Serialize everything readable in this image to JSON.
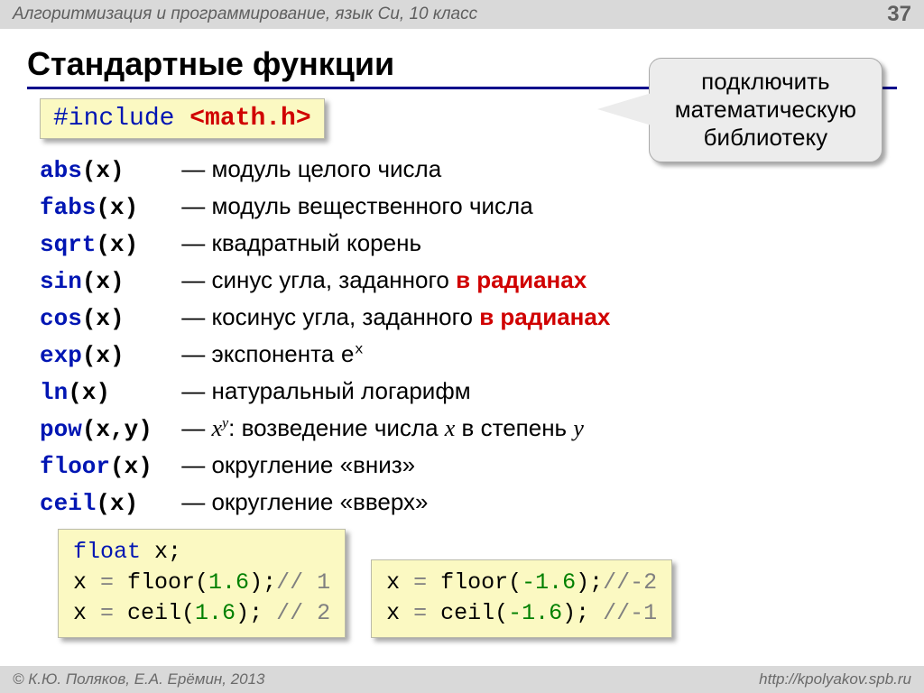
{
  "header": {
    "title": "Алгоритмизация и программирование, язык Си, 10 класс",
    "page": "37"
  },
  "title": "Стандартные функции",
  "include": {
    "kw": "#include",
    "lib": "<math.h>"
  },
  "callout": {
    "l1": "подключить",
    "l2": "математическую",
    "l3": "библиотеку"
  },
  "funcs": [
    {
      "name": "abs",
      "args": "(x)",
      "dash": "—",
      "d1": "модуль целого числа"
    },
    {
      "name": "fabs",
      "args": "(x)",
      "dash": "—",
      "d1": "модуль вещественного числа"
    },
    {
      "name": "sqrt",
      "args": "(x)",
      "dash": "—",
      "d1": "квадратный корень"
    },
    {
      "name": "sin",
      "args": "(x)",
      "dash": "—",
      "d1": "синус угла, заданного ",
      "d2": "в радианах"
    },
    {
      "name": "cos",
      "args": "(x)",
      "dash": "—",
      "d1": "косинус угла, заданного ",
      "d2": "в радианах"
    },
    {
      "name": "exp",
      "args": "(x)",
      "dash": "—",
      "d1": "экспонента ",
      "mono": "e",
      "sup": "x"
    },
    {
      "name": "ln",
      "args": "(x)",
      "dash": "—",
      "d1": "натуральный логарифм"
    },
    {
      "name": "pow",
      "args": "(x,y)",
      "dash": "—",
      "em1": "x",
      "sup": "y",
      "d1": ": возведение числа ",
      "em2": "x",
      "d2": " в степень ",
      "em3": "y"
    },
    {
      "name": "floor",
      "args": "(x)",
      "dash": "—",
      "d1": "округление «вниз»"
    },
    {
      "name": "ceil",
      "args": "(x)",
      "dash": "—",
      "d1": "округление «вверх»"
    }
  ],
  "ex1": {
    "l1a": "float",
    "l1b": " x;",
    "l2a": "x",
    "l2b": " = ",
    "l2c": "floor(",
    "l2d": "1.6",
    "l2e": ");",
    "l2f": "// 1",
    "l3a": "x",
    "l3b": " = ",
    "l3c": "ceil(",
    "l3d": "1.6",
    "l3e": "); ",
    "l3f": "// 2"
  },
  "ex2": {
    "l1a": "x",
    "l1b": " = ",
    "l1c": "floor(",
    "l1d": "-1.6",
    "l1e": ");",
    "l1f": "//-2",
    "l2a": "x",
    "l2b": " = ",
    "l2c": "ceil(",
    "l2d": "-1.6",
    "l2e": "); ",
    "l2f": "//-1"
  },
  "footer": {
    "copy": "© К.Ю. Поляков, Е.А. Ерёмин, 2013",
    "url": "http://kpolyakov.spb.ru"
  }
}
